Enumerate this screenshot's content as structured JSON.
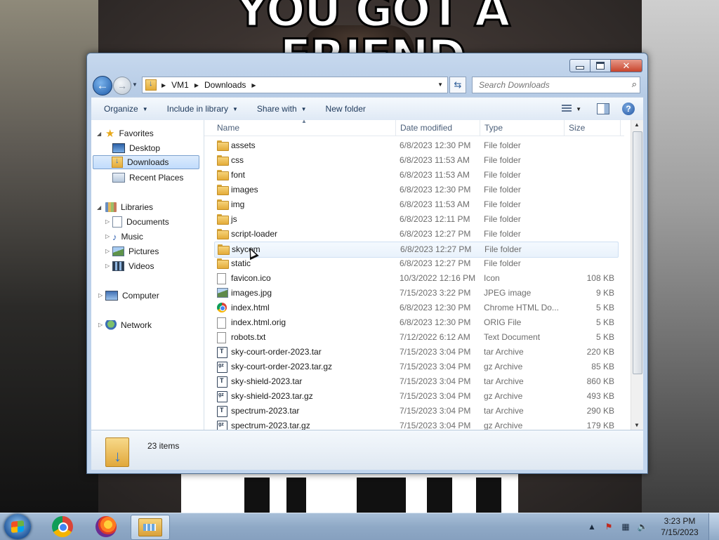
{
  "desktop": {
    "meme_top_text": "YOU GOT A FRIEND"
  },
  "window": {
    "address": {
      "crumbs": [
        "VM1",
        "Downloads"
      ]
    },
    "search": {
      "placeholder": "Search Downloads"
    },
    "toolbar": {
      "organize": "Organize",
      "include_in_library": "Include in library",
      "share_with": "Share with",
      "new_folder": "New folder"
    },
    "nav": {
      "favorites": "Favorites",
      "desktop": "Desktop",
      "downloads": "Downloads",
      "recent_places": "Recent Places",
      "libraries": "Libraries",
      "documents": "Documents",
      "music": "Music",
      "pictures": "Pictures",
      "videos": "Videos",
      "computer": "Computer",
      "network": "Network"
    },
    "columns": {
      "name": "Name",
      "date": "Date modified",
      "type": "Type",
      "size": "Size"
    },
    "files": [
      {
        "name": "assets",
        "date": "6/8/2023 12:30 PM",
        "type": "File folder",
        "size": "",
        "icon": "folder-icon"
      },
      {
        "name": "css",
        "date": "6/8/2023 11:53 AM",
        "type": "File folder",
        "size": "",
        "icon": "folder-icon"
      },
      {
        "name": "font",
        "date": "6/8/2023 11:53 AM",
        "type": "File folder",
        "size": "",
        "icon": "folder-icon"
      },
      {
        "name": "images",
        "date": "6/8/2023 12:30 PM",
        "type": "File folder",
        "size": "",
        "icon": "folder-icon"
      },
      {
        "name": "img",
        "date": "6/8/2023 11:53 AM",
        "type": "File folder",
        "size": "",
        "icon": "folder-icon"
      },
      {
        "name": "js",
        "date": "6/8/2023 12:11 PM",
        "type": "File folder",
        "size": "",
        "icon": "folder-icon"
      },
      {
        "name": "script-loader",
        "date": "6/8/2023 12:27 PM",
        "type": "File folder",
        "size": "",
        "icon": "folder-icon"
      },
      {
        "name": "skycom",
        "date": "6/8/2023 12:27 PM",
        "type": "File folder",
        "size": "",
        "icon": "folder-icon"
      },
      {
        "name": "static",
        "date": "6/8/2023 12:27 PM",
        "type": "File folder",
        "size": "",
        "icon": "folder-icon"
      },
      {
        "name": "favicon.ico",
        "date": "10/3/2022 12:16 PM",
        "type": "Icon",
        "size": "108 KB",
        "icon": "file-icon"
      },
      {
        "name": "images.jpg",
        "date": "7/15/2023 3:22 PM",
        "type": "JPEG image",
        "size": "9 KB",
        "icon": "image-icon"
      },
      {
        "name": "index.html",
        "date": "6/8/2023 12:30 PM",
        "type": "Chrome HTML Do...",
        "size": "5 KB",
        "icon": "chrome-icon"
      },
      {
        "name": "index.html.orig",
        "date": "6/8/2023 12:30 PM",
        "type": "ORIG File",
        "size": "5 KB",
        "icon": "file-icon"
      },
      {
        "name": "robots.txt",
        "date": "7/12/2022 6:12 AM",
        "type": "Text Document",
        "size": "5 KB",
        "icon": "file-icon"
      },
      {
        "name": "sky-court-order-2023.tar",
        "date": "7/15/2023 3:04 PM",
        "type": "tar Archive",
        "size": "220 KB",
        "icon": "tar-icon"
      },
      {
        "name": "sky-court-order-2023.tar.gz",
        "date": "7/15/2023 3:04 PM",
        "type": "gz Archive",
        "size": "85 KB",
        "icon": "gz-icon"
      },
      {
        "name": "sky-shield-2023.tar",
        "date": "7/15/2023 3:04 PM",
        "type": "tar Archive",
        "size": "860 KB",
        "icon": "tar-icon"
      },
      {
        "name": "sky-shield-2023.tar.gz",
        "date": "7/15/2023 3:04 PM",
        "type": "gz Archive",
        "size": "493 KB",
        "icon": "gz-icon"
      },
      {
        "name": "spectrum-2023.tar",
        "date": "7/15/2023 3:04 PM",
        "type": "tar Archive",
        "size": "290 KB",
        "icon": "tar-icon"
      },
      {
        "name": "spectrum-2023.tar.gz",
        "date": "7/15/2023 3:04 PM",
        "type": "gz Archive",
        "size": "179 KB",
        "icon": "gz-icon"
      }
    ],
    "status": {
      "item_count": "23 items"
    }
  },
  "taskbar": {
    "time": "3:23 PM",
    "date": "7/15/2023"
  }
}
